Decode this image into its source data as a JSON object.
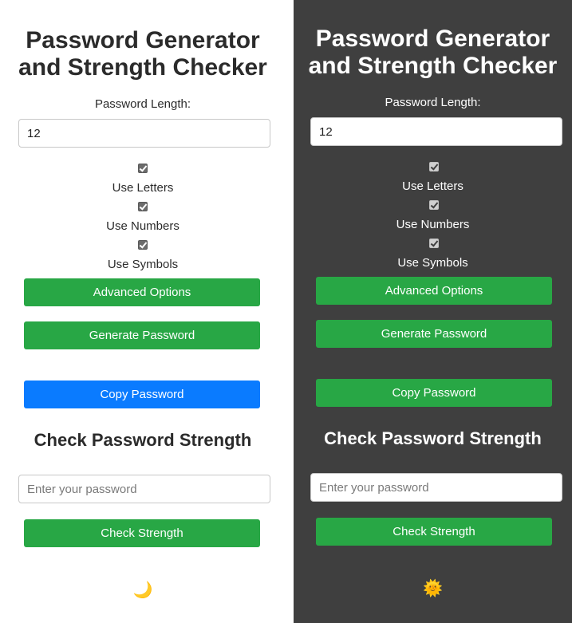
{
  "light": {
    "title_line1": "Password Generator",
    "title_line2": "and Strength Checker",
    "length_label": "Password Length:",
    "length_value": "12",
    "options": [
      {
        "label": "Use Letters",
        "checked": true
      },
      {
        "label": "Use Numbers",
        "checked": true
      },
      {
        "label": "Use Symbols",
        "checked": true
      }
    ],
    "advanced_button": "Advanced Options",
    "generate_button": "Generate Password",
    "copy_button": "Copy Password",
    "strength_title": "Check Password Strength",
    "password_placeholder": "Enter your password",
    "check_button": "Check Strength",
    "theme_toggle": "🌙"
  },
  "dark": {
    "title_line1": "Password Generator",
    "title_line2": "and Strength Checker",
    "length_label": "Password Length:",
    "length_value": "12",
    "options": [
      {
        "label": "Use Letters",
        "checked": true
      },
      {
        "label": "Use Numbers",
        "checked": true
      },
      {
        "label": "Use Symbols",
        "checked": true
      }
    ],
    "advanced_button": "Advanced Options",
    "generate_button": "Generate Password",
    "copy_button": "Copy Password",
    "strength_title": "Check Password Strength",
    "password_placeholder": "Enter your password",
    "check_button": "Check Strength",
    "theme_toggle": "🌞"
  },
  "colors": {
    "green": "#28a745",
    "blue": "#0a7bff",
    "dark_bg": "#3f3f3f"
  }
}
